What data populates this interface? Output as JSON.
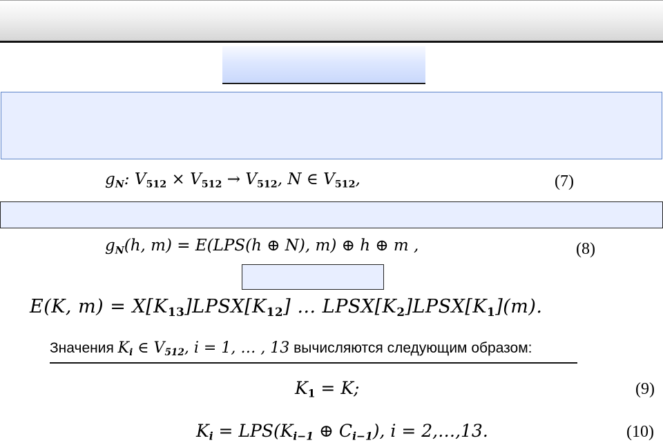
{
  "formula7": {
    "lhs": "g",
    "lhs_sub": "N",
    "body": ": V",
    "s1": "512",
    "times": " × V",
    "s2": "512",
    "arrow": " → V",
    "s3": "512",
    "cond": ", N ∈ V",
    "s4": "512",
    "tail": ",",
    "number": "(7)"
  },
  "formula8": {
    "lhs": "g",
    "lhs_sub": "N",
    "body": "(h, m) = E(LPS(h ⊕ N), m) ⊕ h ⊕ m ,",
    "number": "(8)"
  },
  "formula_e": {
    "part1": "E(K, m) = X[K",
    "s13": "13",
    "part2": "]LPSX[K",
    "s12": "12",
    "part3": "] … LPSX[K",
    "s2": "2",
    "part4": "]LPSX[K",
    "s1": "1",
    "part5": "](m)."
  },
  "ki_line": {
    "prefix": "Значения ",
    "k": "K",
    "k_sub": "i",
    "in": " ∈ V",
    "v_sub": "512",
    "range": ",  i = 1, … , 13",
    "suffix": " вычисляются следующим образом:"
  },
  "formula9": {
    "k": "K",
    "k_sub": "1",
    "rest": " = K;",
    "number": "(9)"
  },
  "formula10": {
    "k": "K",
    "k_sub": "i",
    "mid": " = LPS(K",
    "km1": "i−1",
    "oplus": " ⊕ C",
    "cm1": "i−1",
    "rest": "),  i = 2,…,13.",
    "number": "(10)"
  }
}
